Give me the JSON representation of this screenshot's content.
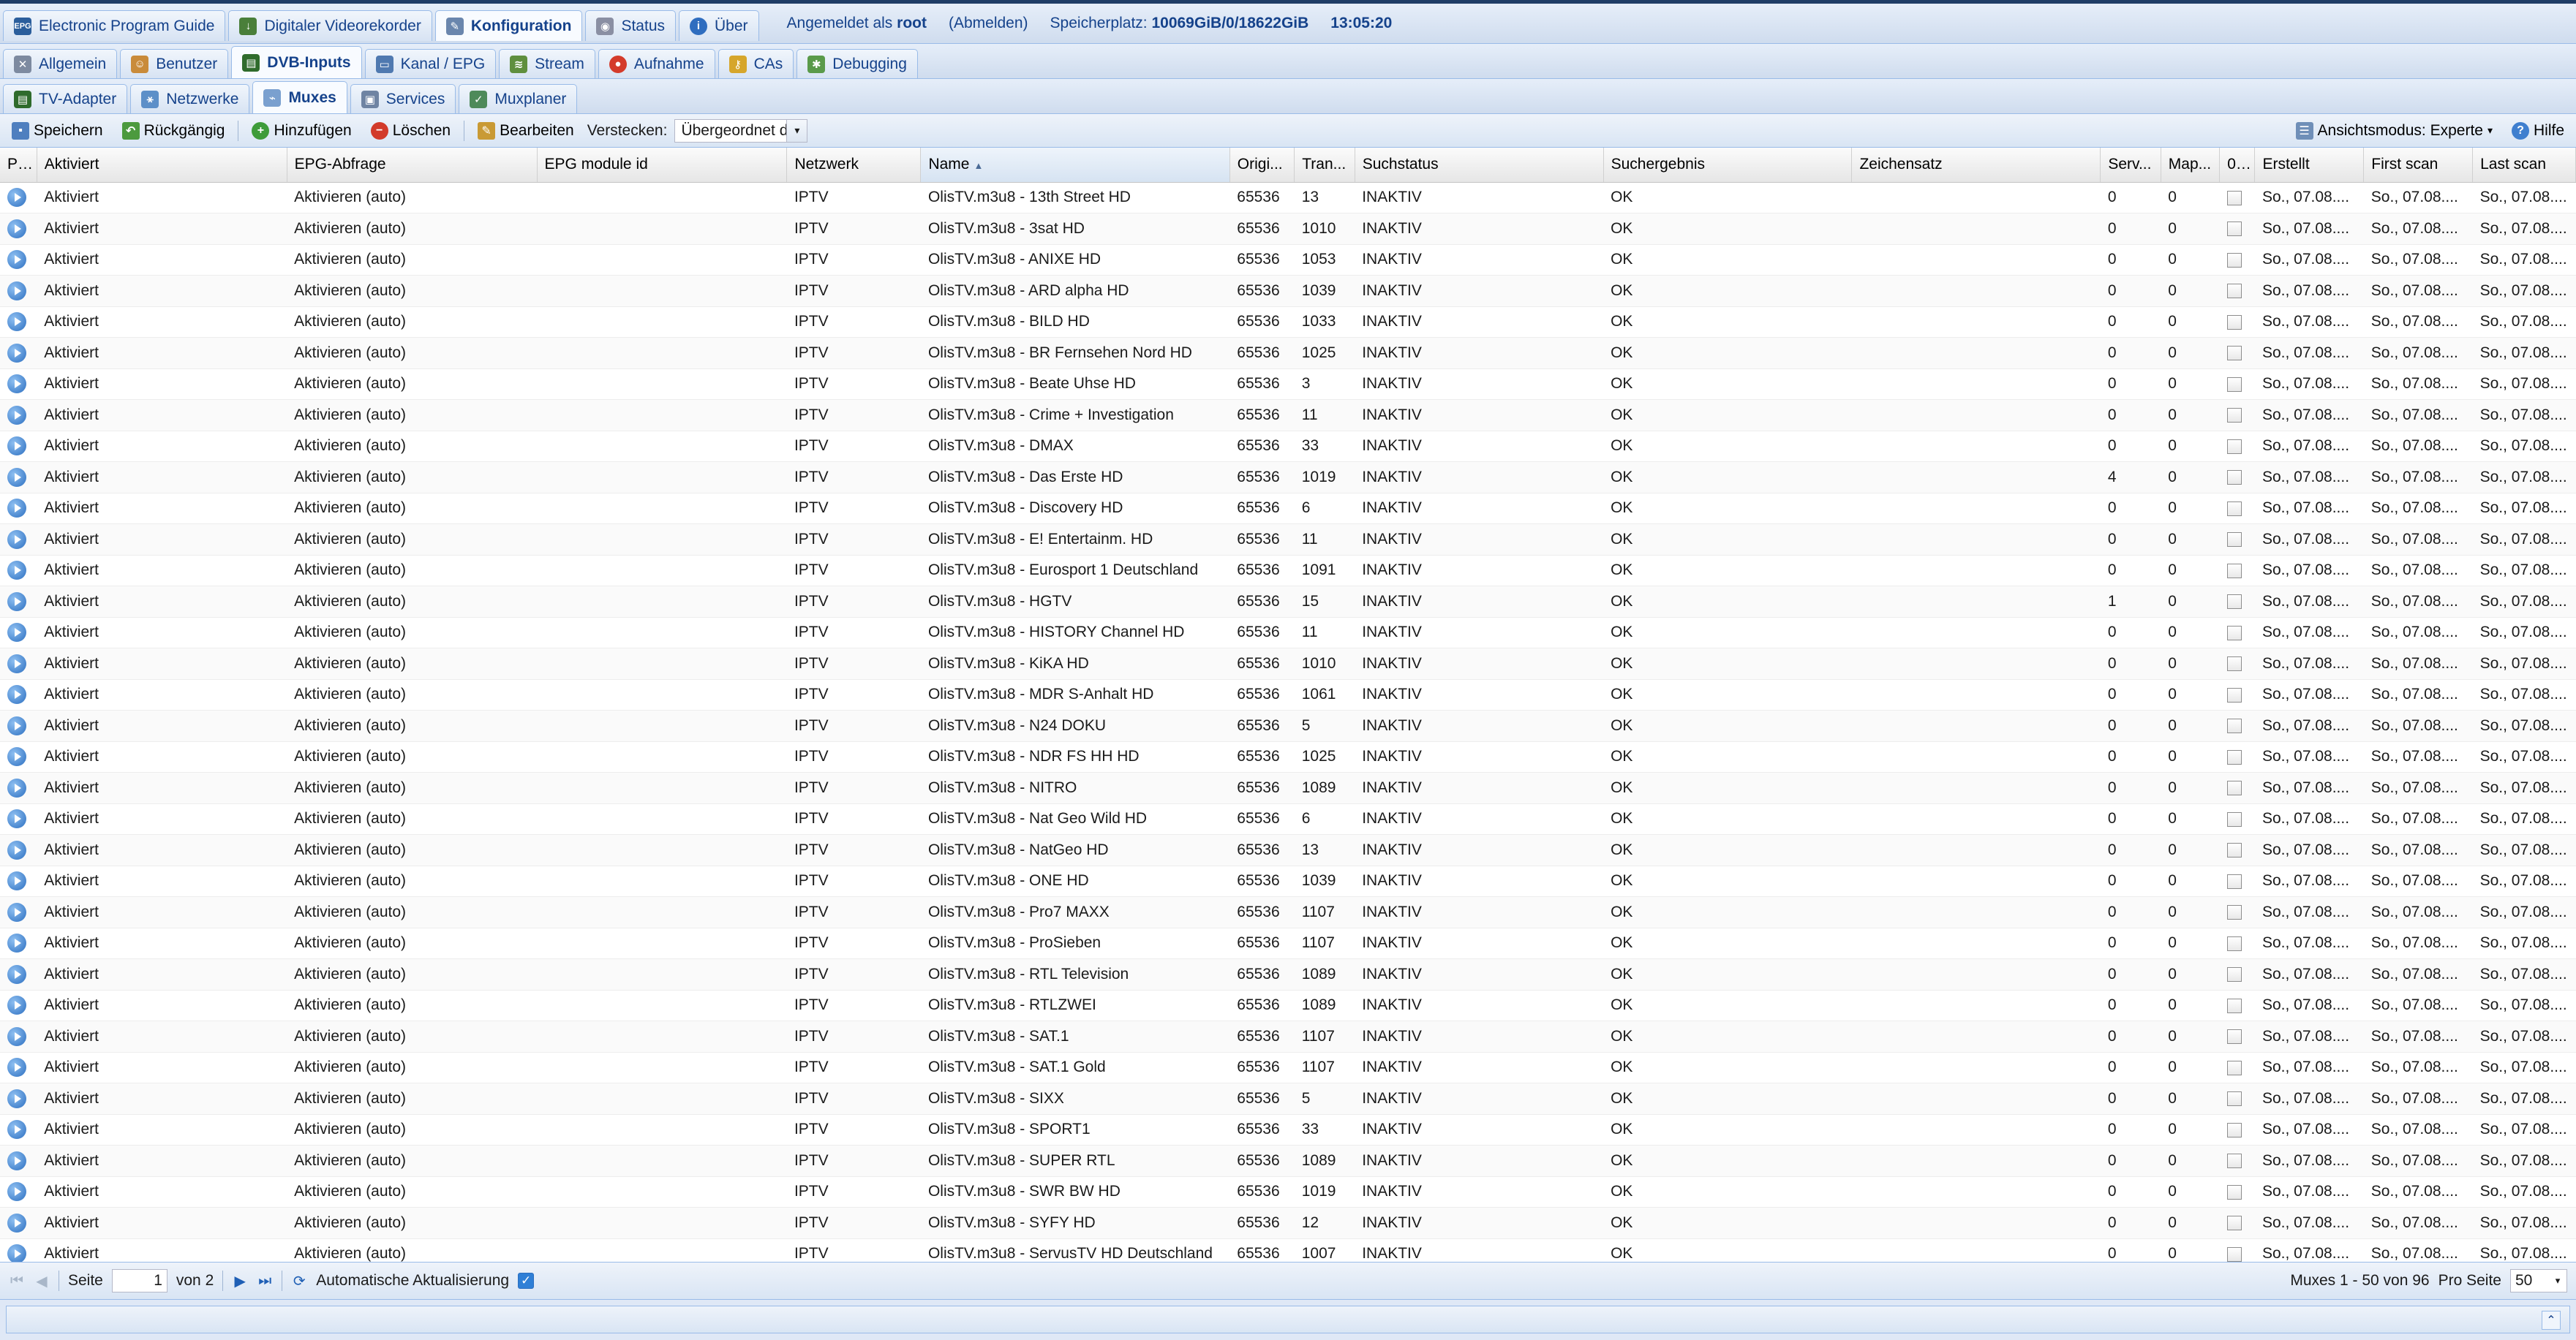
{
  "colors": {
    "accent": "#15428b",
    "header_bar": "#1f3d66",
    "tab_border": "#99bbe8"
  },
  "top_tabs": [
    {
      "label": "Electronic Program Guide",
      "icon": "epg-icon"
    },
    {
      "label": "Digitaler Videorekorder",
      "icon": "recorder-icon"
    },
    {
      "label": "Konfiguration",
      "icon": "wrench-icon"
    },
    {
      "label": "Status",
      "icon": "eye-icon"
    },
    {
      "label": "Über",
      "icon": "info-icon"
    }
  ],
  "session": {
    "logged_in_prefix": "Angemeldet als",
    "user": "root",
    "logout": "(Abmelden)",
    "storage_label": "Speicherplatz:",
    "storage_value": "10069GiB/0/18622GiB",
    "time": "13:05:20"
  },
  "config_tabs": [
    {
      "label": "Allgemein",
      "icon": "tools-icon"
    },
    {
      "label": "Benutzer",
      "icon": "users-icon"
    },
    {
      "label": "DVB-Inputs",
      "icon": "dvb-card-icon"
    },
    {
      "label": "Kanal / EPG",
      "icon": "channel-icon"
    },
    {
      "label": "Stream",
      "icon": "stream-icon"
    },
    {
      "label": "Aufnahme",
      "icon": "record-icon"
    },
    {
      "label": "CAs",
      "icon": "key-icon"
    },
    {
      "label": "Debugging",
      "icon": "debug-icon"
    }
  ],
  "dvb_tabs": [
    {
      "label": "TV-Adapter",
      "icon": "adapter-icon"
    },
    {
      "label": "Netzwerke",
      "icon": "network-icon"
    },
    {
      "label": "Muxes",
      "icon": "mux-icon"
    },
    {
      "label": "Services",
      "icon": "services-icon"
    },
    {
      "label": "Muxplaner",
      "icon": "scheduler-icon"
    }
  ],
  "toolbar": {
    "save": "Speichern",
    "undo": "Rückgängig",
    "add": "Hinzufügen",
    "delete": "Löschen",
    "edit": "Bearbeiten",
    "hide_label": "Verstecken:",
    "hide_value": "Übergeordnet d",
    "view_mode": "Ansichtsmodus: Experte",
    "help": "Hilfe"
  },
  "columns": [
    "Play",
    "Aktiviert",
    "EPG-Abfrage",
    "EPG module id",
    "Netzwerk",
    "Name",
    "Origi...",
    "Tran...",
    "Suchstatus",
    "Suchergebnis",
    "Zeichensatz",
    "Serv...",
    "Map...",
    "0 ...",
    "Erstellt",
    "First scan",
    "Last scan"
  ],
  "row_defaults": {
    "enabled": "Aktiviert",
    "epg": "Aktivieren (auto)",
    "network": "IPTV",
    "onid": "65536",
    "scan_status": "INAKTIV",
    "scan_result": "OK",
    "mapped": "0",
    "date": "So., 07.08...."
  },
  "rows": [
    {
      "name": "OlisTV.m3u8 - 13th Street HD",
      "tsid": "13",
      "services": "0"
    },
    {
      "name": "OlisTV.m3u8 - 3sat HD",
      "tsid": "1010",
      "services": "0"
    },
    {
      "name": "OlisTV.m3u8 - ANIXE HD",
      "tsid": "1053",
      "services": "0"
    },
    {
      "name": "OlisTV.m3u8 - ARD alpha HD",
      "tsid": "1039",
      "services": "0"
    },
    {
      "name": "OlisTV.m3u8 - BILD HD",
      "tsid": "1033",
      "services": "0"
    },
    {
      "name": "OlisTV.m3u8 - BR Fernsehen Nord HD",
      "tsid": "1025",
      "services": "0"
    },
    {
      "name": "OlisTV.m3u8 - Beate Uhse HD",
      "tsid": "3",
      "services": "0"
    },
    {
      "name": "OlisTV.m3u8 - Crime + Investigation",
      "tsid": "11",
      "services": "0"
    },
    {
      "name": "OlisTV.m3u8 - DMAX",
      "tsid": "33",
      "services": "0"
    },
    {
      "name": "OlisTV.m3u8 - Das Erste HD",
      "tsid": "1019",
      "services": "4"
    },
    {
      "name": "OlisTV.m3u8 - Discovery HD",
      "tsid": "6",
      "services": "0"
    },
    {
      "name": "OlisTV.m3u8 - E! Entertainm. HD",
      "tsid": "11",
      "services": "0"
    },
    {
      "name": "OlisTV.m3u8 - Eurosport 1 Deutschland",
      "tsid": "1091",
      "services": "0"
    },
    {
      "name": "OlisTV.m3u8 - HGTV",
      "tsid": "15",
      "services": "1"
    },
    {
      "name": "OlisTV.m3u8 - HISTORY Channel HD",
      "tsid": "11",
      "services": "0"
    },
    {
      "name": "OlisTV.m3u8 - KiKA HD",
      "tsid": "1010",
      "services": "0"
    },
    {
      "name": "OlisTV.m3u8 - MDR S-Anhalt HD",
      "tsid": "1061",
      "services": "0"
    },
    {
      "name": "OlisTV.m3u8 - N24 DOKU",
      "tsid": "5",
      "services": "0"
    },
    {
      "name": "OlisTV.m3u8 - NDR FS HH HD",
      "tsid": "1025",
      "services": "0"
    },
    {
      "name": "OlisTV.m3u8 - NITRO",
      "tsid": "1089",
      "services": "0"
    },
    {
      "name": "OlisTV.m3u8 - Nat Geo Wild HD",
      "tsid": "6",
      "services": "0"
    },
    {
      "name": "OlisTV.m3u8 - NatGeo HD",
      "tsid": "13",
      "services": "0"
    },
    {
      "name": "OlisTV.m3u8 - ONE HD",
      "tsid": "1039",
      "services": "0"
    },
    {
      "name": "OlisTV.m3u8 - Pro7 MAXX",
      "tsid": "1107",
      "services": "0"
    },
    {
      "name": "OlisTV.m3u8 - ProSieben",
      "tsid": "1107",
      "services": "0"
    },
    {
      "name": "OlisTV.m3u8 - RTL Television",
      "tsid": "1089",
      "services": "0"
    },
    {
      "name": "OlisTV.m3u8 - RTLZWEI",
      "tsid": "1089",
      "services": "0"
    },
    {
      "name": "OlisTV.m3u8 - SAT.1",
      "tsid": "1107",
      "services": "0"
    },
    {
      "name": "OlisTV.m3u8 - SAT.1 Gold",
      "tsid": "1107",
      "services": "0"
    },
    {
      "name": "OlisTV.m3u8 - SIXX",
      "tsid": "5",
      "services": "0"
    },
    {
      "name": "OlisTV.m3u8 - SPORT1",
      "tsid": "33",
      "services": "0"
    },
    {
      "name": "OlisTV.m3u8 - SUPER RTL",
      "tsid": "1089",
      "services": "0"
    },
    {
      "name": "OlisTV.m3u8 - SWR BW HD",
      "tsid": "1019",
      "services": "0"
    },
    {
      "name": "OlisTV.m3u8 - SYFY HD",
      "tsid": "12",
      "services": "0"
    },
    {
      "name": "OlisTV.m3u8 - ServusTV HD Deutschland",
      "tsid": "1007",
      "services": "0"
    }
  ],
  "pager": {
    "page_label": "Seite",
    "page": "1",
    "of_label": "von 2",
    "auto_refresh": "Automatische Aktualisierung",
    "summary": "Muxes 1 - 50 von 96",
    "per_page_label": "Pro Seite",
    "per_page": "50"
  }
}
